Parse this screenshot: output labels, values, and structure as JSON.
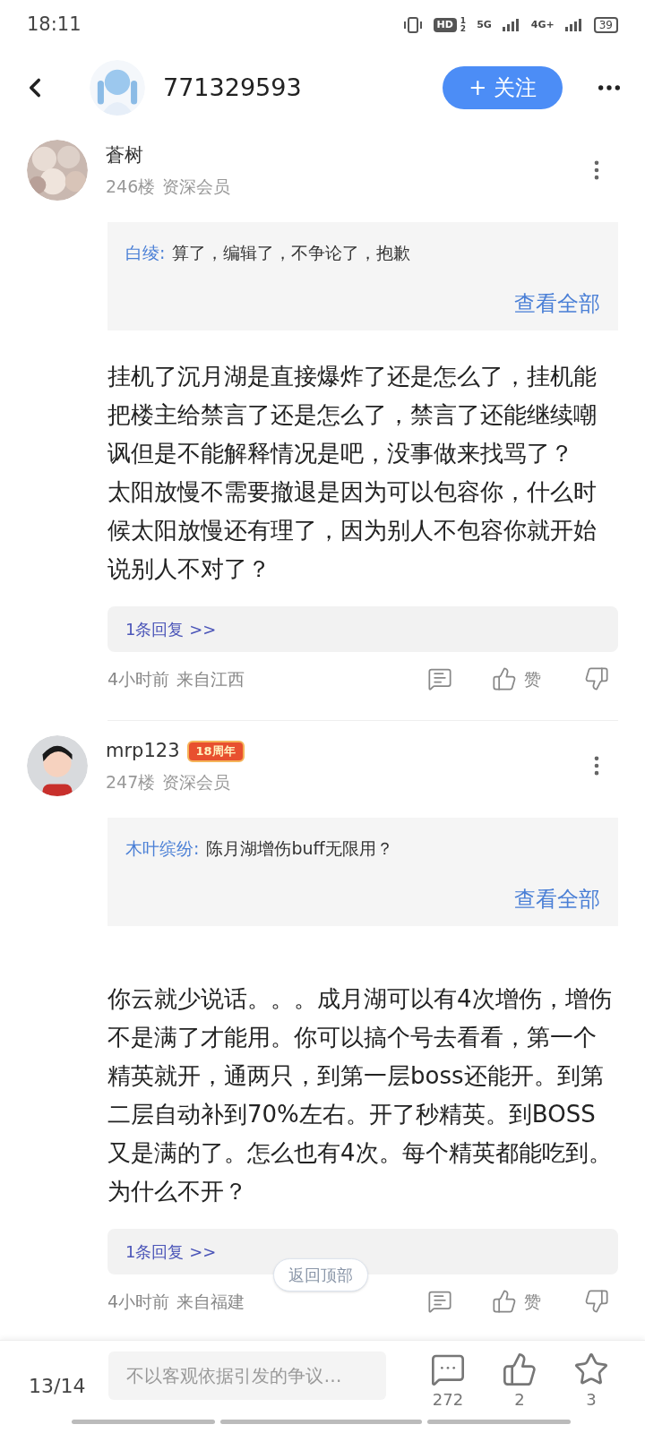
{
  "status_bar": {
    "time": "18:11",
    "hd": "HD",
    "sim_numbers": [
      "1",
      "2"
    ],
    "network_1": "5G",
    "network_2": "4G+",
    "battery": "39"
  },
  "header": {
    "username": "771329593",
    "follow_button": "+ 关注"
  },
  "comments": [
    {
      "name": "蒼树",
      "floor": "246楼",
      "rank": "资深会员",
      "quote": {
        "author": "白绫:",
        "text": "算了，编辑了，不争论了，抱歉",
        "more": "查看全部"
      },
      "paragraphs": [
        "挂机了沉月湖是直接爆炸了还是怎么了，挂机能把楼主给禁言了还是怎么了，禁言了还能继续嘲讽但是不能解释情况是吧，没事做来找骂了？",
        "太阳放慢不需要撤退是因为可以包容你，什么时候太阳放慢还有理了，因为别人不包容你就开始说别人不对了？"
      ],
      "replies": "1条回复 >>",
      "time": "4小时前",
      "location": "来自江西",
      "like_label": "赞"
    },
    {
      "name": "mrp123",
      "badge": "18周年",
      "floor": "247楼",
      "rank": "资深会员",
      "quote": {
        "author": "木叶缤纷:",
        "text": "陈月湖增伤buff无限用？",
        "more": "查看全部"
      },
      "paragraphs": [
        "你云就少说话。。。成月湖可以有4次增伤，增伤不是满了才能用。你可以搞个号去看看，第一个精英就开，通两只，到第一层boss还能开。到第二层自动补到70%左右。开了秒精英。到BOSS又是满的了。怎么也有4次。每个精英都能吃到。为什么不开？"
      ],
      "replies": "1条回复 >>",
      "time": "4小时前",
      "location": "来自福建",
      "like_label": "赞"
    }
  ],
  "back_to_top": "返回顶部",
  "bottom_bar": {
    "page": "13/14",
    "input_placeholder": "不以客观依据引发的争议…",
    "comment_count": "272",
    "like_count": "2",
    "star_count": "3"
  }
}
